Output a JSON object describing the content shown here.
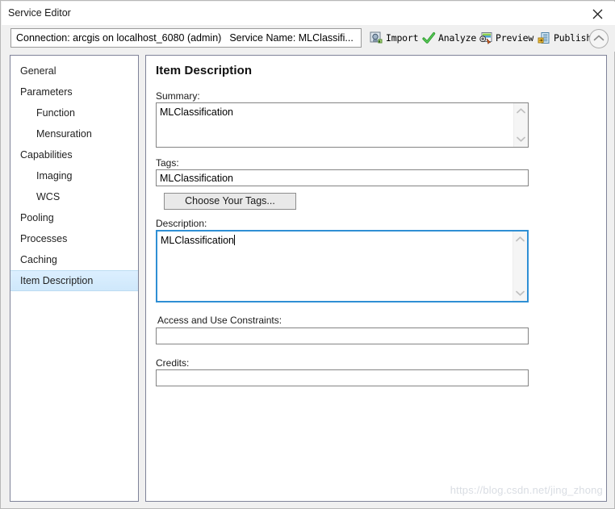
{
  "window": {
    "title": "Service Editor",
    "close_icon": "close-icon"
  },
  "connection_bar": {
    "connection_text": "Connection: arcgis on localhost_6080 (admin)",
    "service_name_text": "Service Name: MLClassifi..."
  },
  "toolbar": {
    "buttons": [
      {
        "label": "Import",
        "icon": "import-icon"
      },
      {
        "label": "Analyze",
        "icon": "checkmark-icon"
      },
      {
        "label": "Preview",
        "icon": "preview-icon"
      },
      {
        "label": "Publish",
        "icon": "publish-icon"
      }
    ],
    "collapse_icon": "chevron-up-icon"
  },
  "sidebar": {
    "items": [
      {
        "label": "General",
        "indent": false,
        "selected": false
      },
      {
        "label": "Parameters",
        "indent": false,
        "selected": false
      },
      {
        "label": "Function",
        "indent": true,
        "selected": false
      },
      {
        "label": "Mensuration",
        "indent": true,
        "selected": false
      },
      {
        "label": "Capabilities",
        "indent": false,
        "selected": false
      },
      {
        "label": "Imaging",
        "indent": true,
        "selected": false
      },
      {
        "label": "WCS",
        "indent": true,
        "selected": false
      },
      {
        "label": "Pooling",
        "indent": false,
        "selected": false
      },
      {
        "label": "Processes",
        "indent": false,
        "selected": false
      },
      {
        "label": "Caching",
        "indent": false,
        "selected": false
      },
      {
        "label": "Item Description",
        "indent": false,
        "selected": true
      }
    ]
  },
  "main": {
    "page_title": "Item Description",
    "fields": {
      "summary": {
        "label": "Summary:",
        "value": "MLClassification",
        "placeholder": ""
      },
      "tags": {
        "label": "Tags:",
        "value": "MLClassification",
        "placeholder": "",
        "button_label": "Choose Your Tags..."
      },
      "description": {
        "label": "Description:",
        "value": "MLClassification",
        "placeholder": "",
        "focused": true
      },
      "access_constraints": {
        "label": "Access and Use Constraints:",
        "value": "",
        "placeholder": ""
      },
      "credits": {
        "label": "Credits:",
        "value": "",
        "placeholder": ""
      }
    }
  },
  "watermark": {
    "text": "https://blog.csdn.net/jing_zhong"
  },
  "colors": {
    "accent_focus_border": "#2f8fd4",
    "selected_nav_bg": "#cfe8fb",
    "panel_border": "#7f8399",
    "watermark": "#d9dde3"
  }
}
